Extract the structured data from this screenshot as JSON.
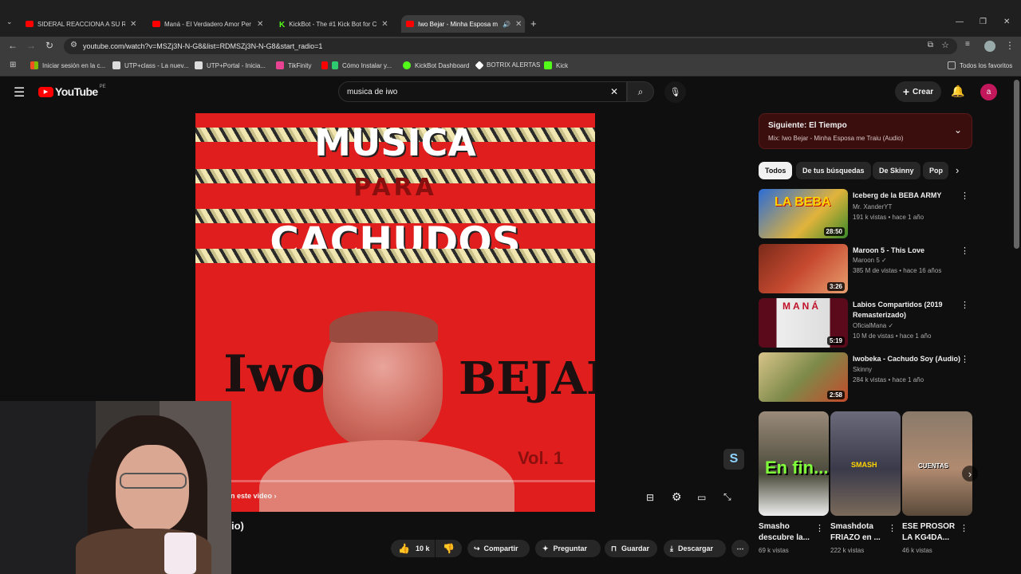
{
  "browser": {
    "tabs": [
      {
        "title": "SIDERAL REACCIONA A SU REP",
        "icon": "youtube-icon"
      },
      {
        "title": "Maná - El Verdadero Amor Per",
        "icon": "youtube-icon"
      },
      {
        "title": "KickBot - The #1 Kick Bot for C",
        "icon": "kick-icon"
      },
      {
        "title": "Iwo Bejar - Minha Esposa m",
        "icon": "youtube-icon"
      }
    ],
    "url": "youtube.com/watch?v=MSZj3N-N-G8&list=RDMSZj3N-N-G8&start_radio=1",
    "bookmarks": [
      "Iniciar sesión en la c...",
      "UTP+class - La nuev...",
      "UTP+Portal - Inicia...",
      "TikFinity",
      "Cómo Instalar y...",
      "KickBot Dashboard",
      "BOTRIX ALERTAS",
      "Kick"
    ],
    "all_bookmarks": "Todos los favoritos"
  },
  "youtube": {
    "logo": "YouTube",
    "region": "PE",
    "search_query": "musica de iwo",
    "create_label": "Crear",
    "avatar_letter": "a"
  },
  "video": {
    "art_line1": "MUSICA",
    "art_line2": "PARA",
    "art_line3": "CACHUDOS",
    "art_left": "Iwo",
    "art_right": "BEJAR",
    "art_vol": "Vol. 1",
    "overlay_link": "n este video",
    "title_fragment": "io)"
  },
  "actions": {
    "likes": "10 k",
    "share": "Compartir",
    "ask": "Preguntar",
    "save": "Guardar",
    "download": "Descargar"
  },
  "up_next": {
    "label": "Siguiente: El Tiempo",
    "subtitle": "Mix: Iwo Bejar - Minha Esposa me Traiu (Audio)"
  },
  "chips": [
    "Todos",
    "De tus búsquedas",
    "De Skinny",
    "Pop"
  ],
  "related": [
    {
      "title": "Iceberg de la BEBA ARMY",
      "channel": "Mr. XanderYT",
      "meta": "191 k vistas • hace 1 año",
      "duration": "28:50"
    },
    {
      "title": "Maroon 5 - This Love",
      "channel": "Maroon 5",
      "meta": "385 M de vistas • hace 16 años",
      "duration": "3:26"
    },
    {
      "title": "Labios Compartidos (2019 Remasterizado)",
      "channel": "OficialMana",
      "meta": "10 M de vistas • hace 1 año",
      "duration": "5:19"
    },
    {
      "title": "Iwobeka - Cachudo Soy (Audio)",
      "channel": "Skinny",
      "meta": "284 k vistas • hace 1 año",
      "duration": "2:58"
    }
  ],
  "thumb_text": {
    "beba": "LA BEBA",
    "mana": "MANÁ"
  },
  "shorts": [
    {
      "title": "Smasho descubre la...",
      "views": "69 k vistas",
      "overlay": "En fin..."
    },
    {
      "title": "Smashdota FRIAZO en ...",
      "views": "222 k vistas",
      "overlay": "SMASH"
    },
    {
      "title": "ESE PROSOR LA KG4DA...",
      "views": "46 k vistas",
      "overlay": "CUENTAS"
    }
  ],
  "colors": {
    "accent": "#ff0000",
    "background": "#0f0f0f",
    "video_bg": "#e01e1e",
    "kick": "#53fc18"
  }
}
